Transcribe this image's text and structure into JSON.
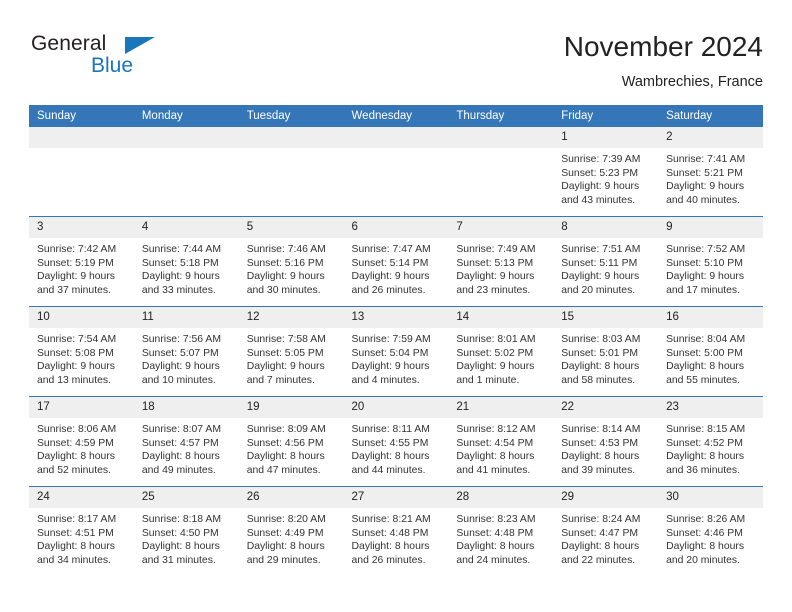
{
  "brand": {
    "general": "General",
    "blue": "Blue",
    "triangle_color": "#1b75bb",
    "text_color": "#231f20"
  },
  "header": {
    "title": "November 2024",
    "subtitle": "Wambrechies, France"
  },
  "colors": {
    "header_bar": "#3476b8",
    "date_band": "#efefef",
    "grid_line": "#3476b8",
    "text": "#222222"
  },
  "calendar": {
    "weekday_headers": [
      "Sunday",
      "Monday",
      "Tuesday",
      "Wednesday",
      "Thursday",
      "Friday",
      "Saturday"
    ],
    "weeks": [
      [
        {
          "day": "",
          "lines": []
        },
        {
          "day": "",
          "lines": []
        },
        {
          "day": "",
          "lines": []
        },
        {
          "day": "",
          "lines": []
        },
        {
          "day": "",
          "lines": []
        },
        {
          "day": "1",
          "lines": [
            "Sunrise: 7:39 AM",
            "Sunset: 5:23 PM",
            "Daylight: 9 hours",
            "and 43 minutes."
          ]
        },
        {
          "day": "2",
          "lines": [
            "Sunrise: 7:41 AM",
            "Sunset: 5:21 PM",
            "Daylight: 9 hours",
            "and 40 minutes."
          ]
        }
      ],
      [
        {
          "day": "3",
          "lines": [
            "Sunrise: 7:42 AM",
            "Sunset: 5:19 PM",
            "Daylight: 9 hours",
            "and 37 minutes."
          ]
        },
        {
          "day": "4",
          "lines": [
            "Sunrise: 7:44 AM",
            "Sunset: 5:18 PM",
            "Daylight: 9 hours",
            "and 33 minutes."
          ]
        },
        {
          "day": "5",
          "lines": [
            "Sunrise: 7:46 AM",
            "Sunset: 5:16 PM",
            "Daylight: 9 hours",
            "and 30 minutes."
          ]
        },
        {
          "day": "6",
          "lines": [
            "Sunrise: 7:47 AM",
            "Sunset: 5:14 PM",
            "Daylight: 9 hours",
            "and 26 minutes."
          ]
        },
        {
          "day": "7",
          "lines": [
            "Sunrise: 7:49 AM",
            "Sunset: 5:13 PM",
            "Daylight: 9 hours",
            "and 23 minutes."
          ]
        },
        {
          "day": "8",
          "lines": [
            "Sunrise: 7:51 AM",
            "Sunset: 5:11 PM",
            "Daylight: 9 hours",
            "and 20 minutes."
          ]
        },
        {
          "day": "9",
          "lines": [
            "Sunrise: 7:52 AM",
            "Sunset: 5:10 PM",
            "Daylight: 9 hours",
            "and 17 minutes."
          ]
        }
      ],
      [
        {
          "day": "10",
          "lines": [
            "Sunrise: 7:54 AM",
            "Sunset: 5:08 PM",
            "Daylight: 9 hours",
            "and 13 minutes."
          ]
        },
        {
          "day": "11",
          "lines": [
            "Sunrise: 7:56 AM",
            "Sunset: 5:07 PM",
            "Daylight: 9 hours",
            "and 10 minutes."
          ]
        },
        {
          "day": "12",
          "lines": [
            "Sunrise: 7:58 AM",
            "Sunset: 5:05 PM",
            "Daylight: 9 hours",
            "and 7 minutes."
          ]
        },
        {
          "day": "13",
          "lines": [
            "Sunrise: 7:59 AM",
            "Sunset: 5:04 PM",
            "Daylight: 9 hours",
            "and 4 minutes."
          ]
        },
        {
          "day": "14",
          "lines": [
            "Sunrise: 8:01 AM",
            "Sunset: 5:02 PM",
            "Daylight: 9 hours",
            "and 1 minute."
          ]
        },
        {
          "day": "15",
          "lines": [
            "Sunrise: 8:03 AM",
            "Sunset: 5:01 PM",
            "Daylight: 8 hours",
            "and 58 minutes."
          ]
        },
        {
          "day": "16",
          "lines": [
            "Sunrise: 8:04 AM",
            "Sunset: 5:00 PM",
            "Daylight: 8 hours",
            "and 55 minutes."
          ]
        }
      ],
      [
        {
          "day": "17",
          "lines": [
            "Sunrise: 8:06 AM",
            "Sunset: 4:59 PM",
            "Daylight: 8 hours",
            "and 52 minutes."
          ]
        },
        {
          "day": "18",
          "lines": [
            "Sunrise: 8:07 AM",
            "Sunset: 4:57 PM",
            "Daylight: 8 hours",
            "and 49 minutes."
          ]
        },
        {
          "day": "19",
          "lines": [
            "Sunrise: 8:09 AM",
            "Sunset: 4:56 PM",
            "Daylight: 8 hours",
            "and 47 minutes."
          ]
        },
        {
          "day": "20",
          "lines": [
            "Sunrise: 8:11 AM",
            "Sunset: 4:55 PM",
            "Daylight: 8 hours",
            "and 44 minutes."
          ]
        },
        {
          "day": "21",
          "lines": [
            "Sunrise: 8:12 AM",
            "Sunset: 4:54 PM",
            "Daylight: 8 hours",
            "and 41 minutes."
          ]
        },
        {
          "day": "22",
          "lines": [
            "Sunrise: 8:14 AM",
            "Sunset: 4:53 PM",
            "Daylight: 8 hours",
            "and 39 minutes."
          ]
        },
        {
          "day": "23",
          "lines": [
            "Sunrise: 8:15 AM",
            "Sunset: 4:52 PM",
            "Daylight: 8 hours",
            "and 36 minutes."
          ]
        }
      ],
      [
        {
          "day": "24",
          "lines": [
            "Sunrise: 8:17 AM",
            "Sunset: 4:51 PM",
            "Daylight: 8 hours",
            "and 34 minutes."
          ]
        },
        {
          "day": "25",
          "lines": [
            "Sunrise: 8:18 AM",
            "Sunset: 4:50 PM",
            "Daylight: 8 hours",
            "and 31 minutes."
          ]
        },
        {
          "day": "26",
          "lines": [
            "Sunrise: 8:20 AM",
            "Sunset: 4:49 PM",
            "Daylight: 8 hours",
            "and 29 minutes."
          ]
        },
        {
          "day": "27",
          "lines": [
            "Sunrise: 8:21 AM",
            "Sunset: 4:48 PM",
            "Daylight: 8 hours",
            "and 26 minutes."
          ]
        },
        {
          "day": "28",
          "lines": [
            "Sunrise: 8:23 AM",
            "Sunset: 4:48 PM",
            "Daylight: 8 hours",
            "and 24 minutes."
          ]
        },
        {
          "day": "29",
          "lines": [
            "Sunrise: 8:24 AM",
            "Sunset: 4:47 PM",
            "Daylight: 8 hours",
            "and 22 minutes."
          ]
        },
        {
          "day": "30",
          "lines": [
            "Sunrise: 8:26 AM",
            "Sunset: 4:46 PM",
            "Daylight: 8 hours",
            "and 20 minutes."
          ]
        }
      ]
    ]
  }
}
